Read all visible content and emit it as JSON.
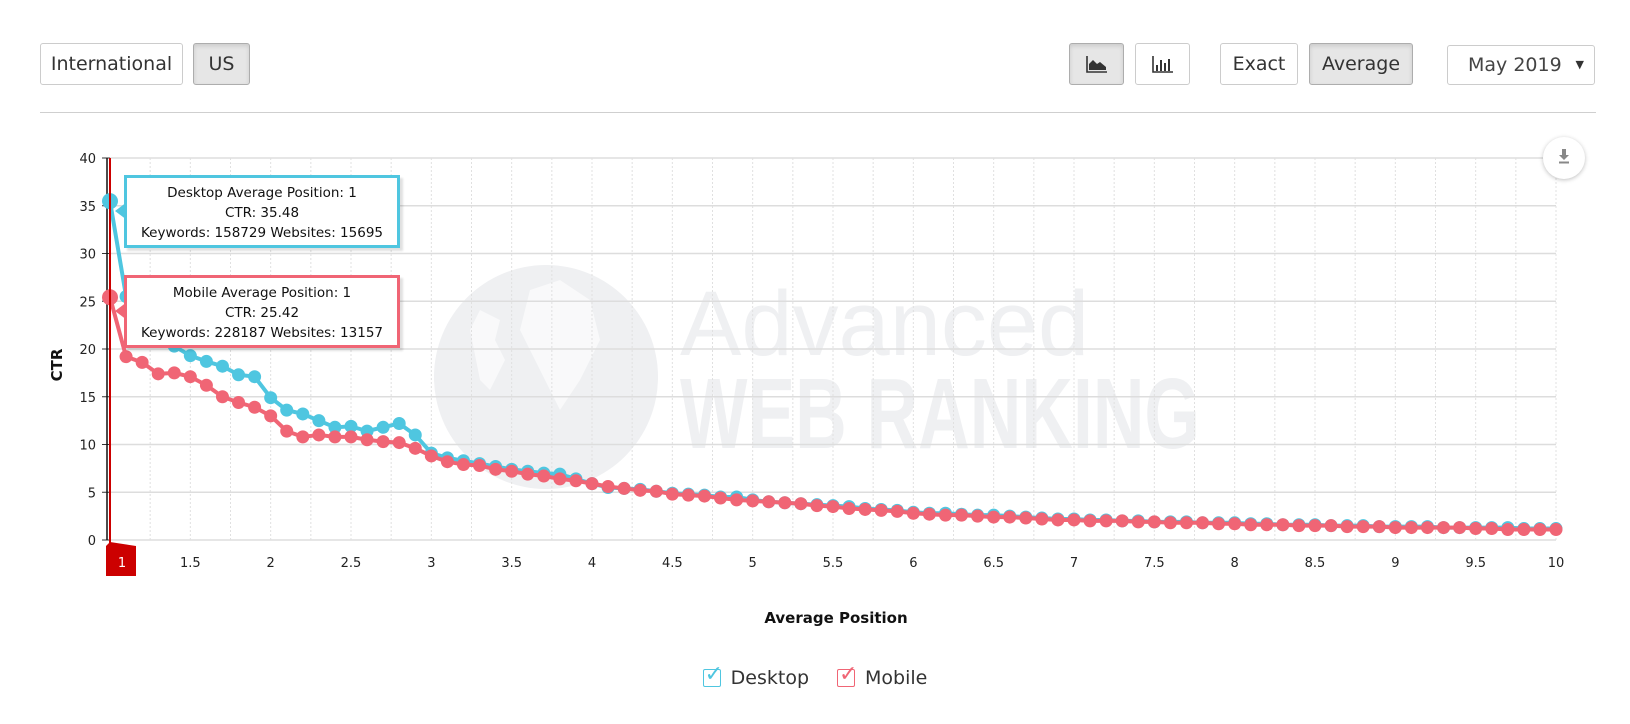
{
  "toolbar": {
    "region_buttons": [
      {
        "label": "International",
        "active": false
      },
      {
        "label": "US",
        "active": true
      }
    ],
    "chart_type_buttons": [
      {
        "icon": "area-chart-icon",
        "active": true
      },
      {
        "icon": "bar-chart-icon",
        "active": false
      }
    ],
    "mode_buttons": [
      {
        "label": "Exact",
        "active": false
      },
      {
        "label": "Average",
        "active": true
      }
    ],
    "date_select": {
      "value": "May 2019"
    }
  },
  "colors": {
    "desktop": "#4fc6e0",
    "mobile": "#f06575",
    "marker_flag": "#cc0000",
    "grid": "#dddddd"
  },
  "tooltips": {
    "desktop": {
      "line1": "Desktop Average Position: 1",
      "line2": "CTR: 35.48",
      "line3": "Keywords: 158729 Websites: 15695"
    },
    "mobile": {
      "line1": "Mobile Average Position: 1",
      "line2": "CTR: 25.42",
      "line3": "Keywords: 228187 Websites: 13157"
    }
  },
  "watermark": {
    "line1": "Advanced",
    "line2": "WEB RANKING"
  },
  "position_flag": {
    "label": "1"
  },
  "legend": [
    {
      "label": "Desktop",
      "checked": true
    },
    {
      "label": "Mobile",
      "checked": true
    }
  ],
  "chart_data": {
    "type": "line",
    "title": "",
    "xlabel": "Average Position",
    "ylabel": "CTR",
    "xlim": [
      1,
      10
    ],
    "ylim": [
      0,
      40
    ],
    "x_ticks": [
      "1",
      "1.5",
      "2",
      "2.5",
      "3",
      "3.5",
      "4",
      "4.5",
      "5",
      "5.5",
      "6",
      "6.5",
      "7",
      "7.5",
      "8",
      "8.5",
      "9",
      "9.5",
      "10"
    ],
    "y_ticks": [
      "0",
      "5",
      "10",
      "15",
      "20",
      "25",
      "30",
      "35",
      "40"
    ],
    "grid": true,
    "legend_position": "bottom-center",
    "x_start": 1,
    "x_step": 0.1,
    "series": [
      {
        "name": "Desktop",
        "values": [
          35.48,
          25.5,
          23.3,
          21.3,
          20.3,
          19.3,
          18.7,
          18.2,
          17.3,
          17.1,
          14.9,
          13.6,
          13.2,
          12.5,
          11.8,
          11.9,
          11.4,
          11.8,
          12.2,
          11.0,
          9.1,
          8.6,
          8.3,
          8.0,
          7.7,
          7.4,
          7.2,
          7.0,
          6.9,
          6.4,
          5.9,
          5.5,
          5.4,
          5.3,
          5.1,
          4.9,
          4.8,
          4.7,
          4.5,
          4.5,
          4.2,
          4.0,
          3.9,
          3.8,
          3.7,
          3.6,
          3.5,
          3.3,
          3.2,
          3.1,
          2.9,
          2.8,
          2.8,
          2.7,
          2.6,
          2.6,
          2.5,
          2.4,
          2.3,
          2.2,
          2.2,
          2.1,
          2.1,
          2.0,
          2.0,
          1.9,
          1.9,
          1.9,
          1.8,
          1.8,
          1.8,
          1.7,
          1.7,
          1.6,
          1.6,
          1.6,
          1.5,
          1.5,
          1.5,
          1.4,
          1.4,
          1.4,
          1.4,
          1.3,
          1.3,
          1.3,
          1.3,
          1.3,
          1.2,
          1.2,
          1.2
        ]
      },
      {
        "name": "Mobile",
        "values": [
          25.42,
          19.2,
          18.6,
          17.4,
          17.5,
          17.1,
          16.2,
          15.0,
          14.4,
          13.9,
          13.0,
          11.4,
          10.8,
          11.0,
          10.8,
          10.8,
          10.5,
          10.3,
          10.2,
          9.6,
          8.8,
          8.2,
          7.9,
          7.8,
          7.4,
          7.2,
          6.9,
          6.7,
          6.4,
          6.2,
          5.9,
          5.6,
          5.4,
          5.2,
          5.1,
          4.8,
          4.7,
          4.6,
          4.4,
          4.2,
          4.1,
          4.0,
          3.9,
          3.8,
          3.6,
          3.5,
          3.3,
          3.2,
          3.1,
          3.0,
          2.8,
          2.7,
          2.6,
          2.6,
          2.5,
          2.4,
          2.4,
          2.3,
          2.2,
          2.1,
          2.1,
          2.0,
          2.0,
          2.0,
          1.9,
          1.9,
          1.8,
          1.8,
          1.8,
          1.7,
          1.7,
          1.6,
          1.6,
          1.6,
          1.5,
          1.5,
          1.5,
          1.4,
          1.4,
          1.4,
          1.3,
          1.3,
          1.3,
          1.3,
          1.3,
          1.2,
          1.2,
          1.1,
          1.1,
          1.1,
          1.1
        ]
      }
    ]
  }
}
